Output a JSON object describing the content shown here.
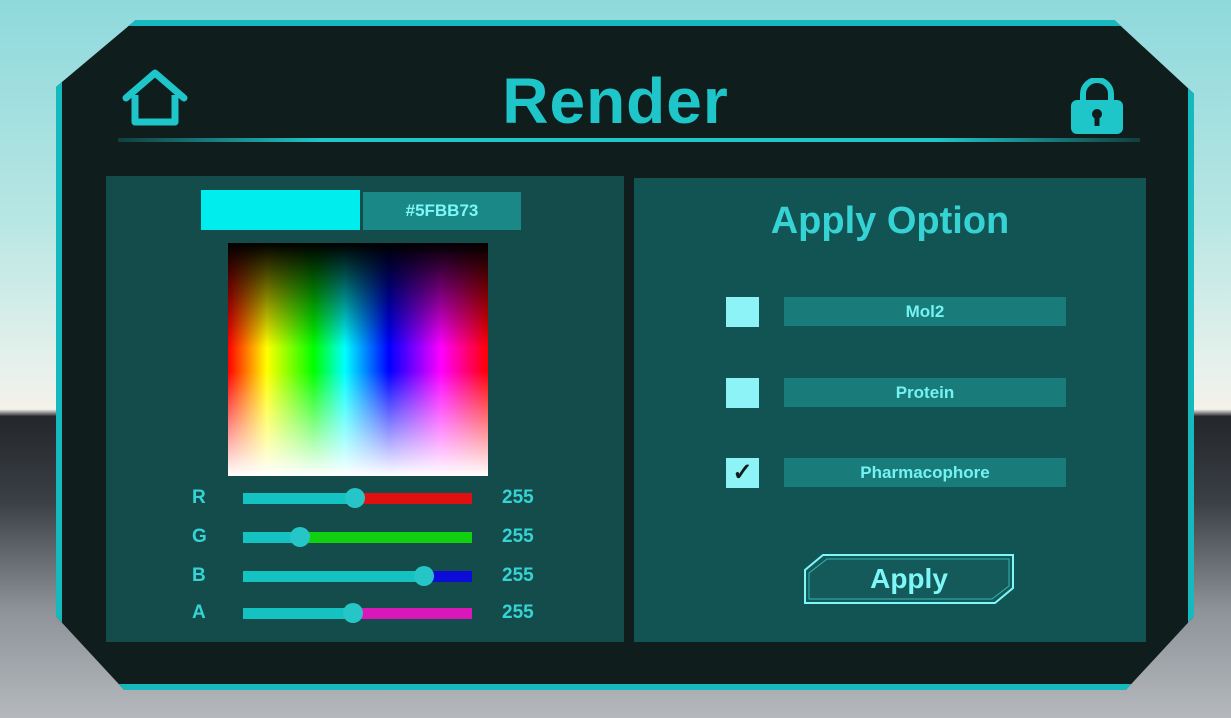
{
  "header": {
    "title": "Render",
    "home_icon": "home-icon",
    "lock_icon": "lock-icon"
  },
  "color_picker": {
    "current_color": "#00EDED",
    "hex_label": "#5FBB73",
    "sliders": [
      {
        "label": "R",
        "value": "255",
        "position": 0.49,
        "color": "#e01010"
      },
      {
        "label": "G",
        "value": "255",
        "position": 0.25,
        "color": "#10d010"
      },
      {
        "label": "B",
        "value": "255",
        "position": 0.79,
        "color": "#0c0cd8"
      },
      {
        "label": "A",
        "value": "255",
        "position": 0.48,
        "color": "#d818b8"
      }
    ]
  },
  "apply_options": {
    "heading": "Apply Option",
    "options": [
      {
        "label": "Mol2",
        "checked": false,
        "check_mark": ""
      },
      {
        "label": "Protein",
        "checked": false,
        "check_mark": ""
      },
      {
        "label": "Pharmacophore",
        "checked": true,
        "check_mark": "✓"
      }
    ],
    "apply_button": "Apply"
  },
  "colors": {
    "accent": "#1fc6c9",
    "panel_bg": "#0f1d1d"
  }
}
